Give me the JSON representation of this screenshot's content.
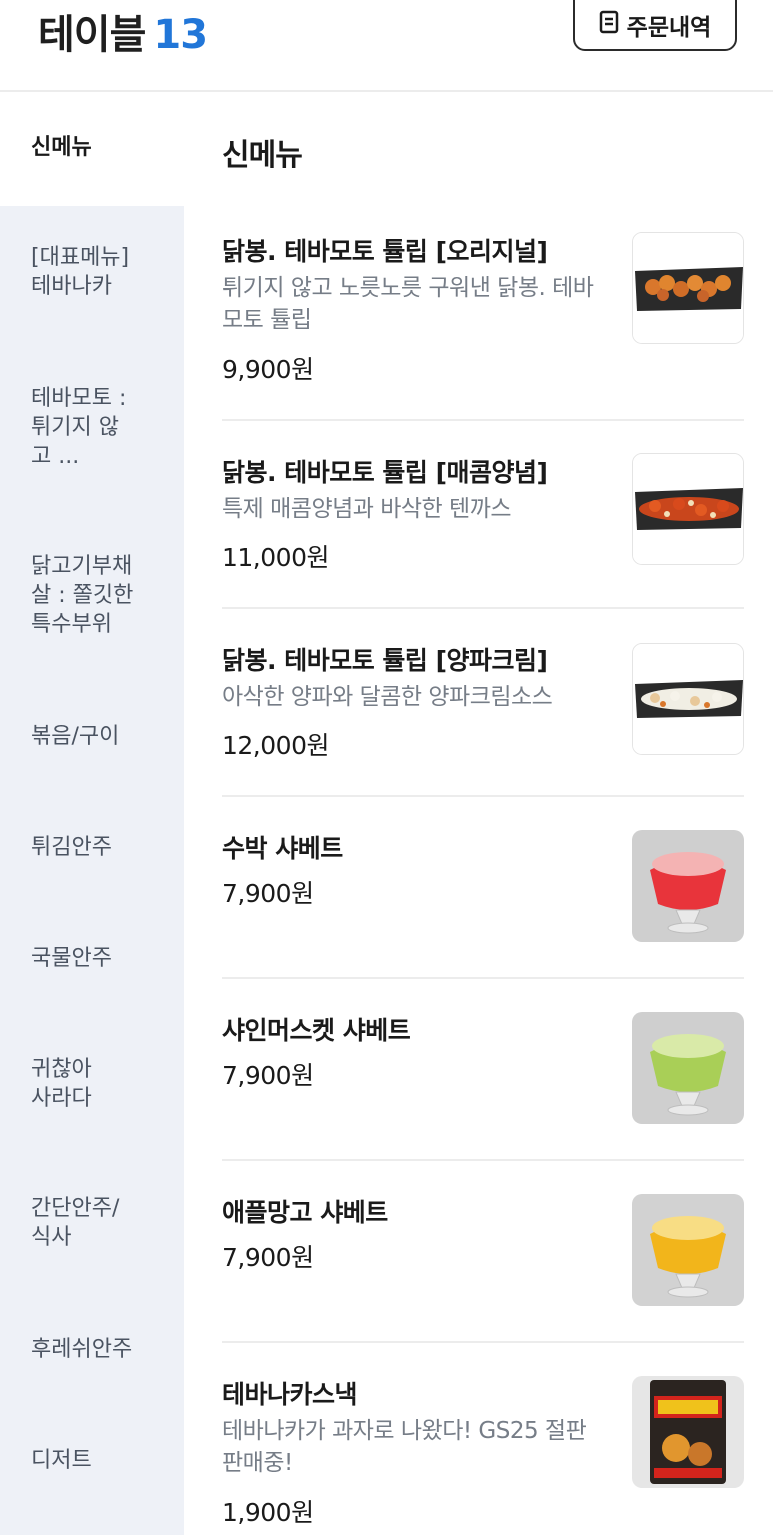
{
  "header": {
    "table_label": "테이블",
    "table_number": "13",
    "history_button": "주문내역"
  },
  "sidebar": {
    "items": [
      {
        "label": "신메뉴"
      },
      {
        "label": "[대표메뉴] 테바나카"
      },
      {
        "label": "테바모토 : 튀기지 않고 ..."
      },
      {
        "label": "닭고기부채살 : 쫄깃한 특수부위"
      },
      {
        "label": "볶음/구이"
      },
      {
        "label": "튀김안주"
      },
      {
        "label": "국물안주"
      },
      {
        "label": "귀찮아 사라다"
      },
      {
        "label": "간단안주/식사"
      },
      {
        "label": "후레쉬안주"
      },
      {
        "label": "디저트"
      }
    ]
  },
  "main": {
    "section_title": "신메뉴",
    "items": [
      {
        "name": "닭봉. 테바모토 튤립  [오리지널]",
        "desc": "튀기지 않고 노릇노릇 구워낸 닭봉. 테바모토 튤립",
        "price": "9,900원",
        "image": "chicken-platter-original"
      },
      {
        "name": "닭봉. 테바모토 튤립  [매콤양념]",
        "desc": "특제 매콤양념과 바삭한 텐까스",
        "price": "11,000원",
        "image": "chicken-platter-spicy"
      },
      {
        "name": "닭봉. 테바모토 튤립  [양파크림]",
        "desc": "아삭한 양파와 달콤한 양파크림소스",
        "price": "12,000원",
        "image": "chicken-platter-onion-cream"
      },
      {
        "name": "수박 샤베트",
        "desc": "",
        "price": "7,900원",
        "image": "watermelon-sorbet"
      },
      {
        "name": "샤인머스켓 샤베트",
        "desc": "",
        "price": "7,900원",
        "image": "shine-muscat-sorbet"
      },
      {
        "name": "애플망고 샤베트",
        "desc": "",
        "price": "7,900원",
        "image": "apple-mango-sorbet"
      },
      {
        "name": "테바나카스낵",
        "desc": "테바나카가 과자로 나왔다! GS25 절판 판매중!",
        "price": "1,900원",
        "image": "snack-bag"
      }
    ]
  },
  "colors": {
    "accent": "#2176d8",
    "sidebar_bg": "#eef1f7",
    "muted_text": "#767d87"
  }
}
